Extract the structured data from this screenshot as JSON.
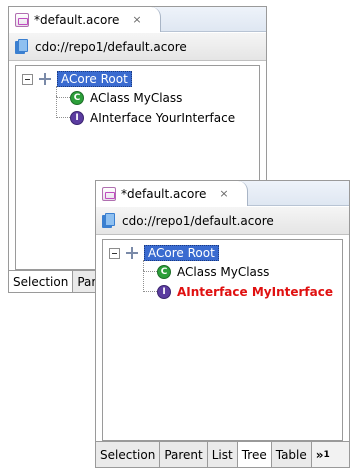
{
  "editor_back": {
    "tab": {
      "title": "*default.acore"
    },
    "uri": "cdo://repo1/default.acore",
    "tree": {
      "root": "ACore Root",
      "children": [
        {
          "kind": "class",
          "label": "AClass MyClass"
        },
        {
          "kind": "interface",
          "label": "AInterface YourInterface"
        }
      ]
    },
    "bottom_tabs": [
      "Selection",
      "Par"
    ]
  },
  "editor_front": {
    "tab": {
      "title": "*default.acore"
    },
    "uri": "cdo://repo1/default.acore",
    "tree": {
      "root": "ACore Root",
      "children": [
        {
          "kind": "class",
          "label": "AClass MyClass"
        },
        {
          "kind": "interface",
          "label": "AInterface MyInterface",
          "changed": true
        }
      ]
    },
    "bottom_tabs": [
      "Selection",
      "Parent",
      "List",
      "Tree",
      "Table"
    ],
    "active_tab": "Tree",
    "more_tabs": {
      "symbol": "»",
      "count": "1"
    }
  },
  "icons": {
    "close": "×",
    "class_letter": "C",
    "interface_letter": "I"
  },
  "colors": {
    "selection": "#3a6bd0",
    "changed_text": "#e01010",
    "class_icon": "#2c9f3a",
    "interface_icon": "#5b3ca0"
  }
}
